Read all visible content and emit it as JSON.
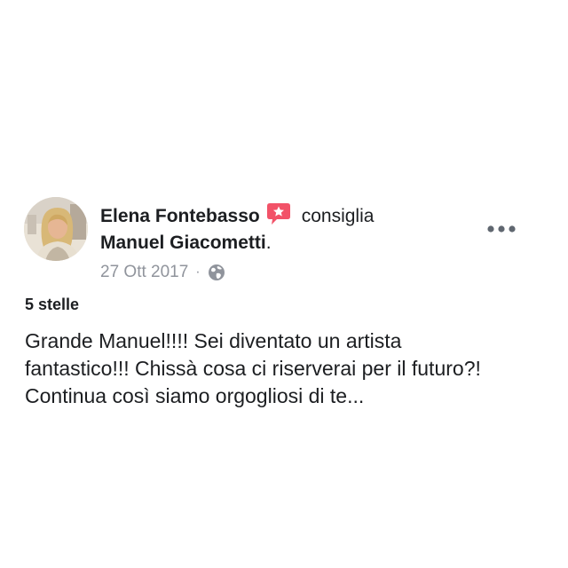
{
  "post": {
    "author": "Elena Fontebasso",
    "recommends_verb": "consiglia",
    "page_name": "Manuel Giacometti",
    "period": ".",
    "date": "27 Ott 2017",
    "separator": "·",
    "privacy_icon": "globe-icon",
    "recommend_icon": "recommendation-badge-icon",
    "more_icon": "more-options-icon",
    "rating": "5 stelle",
    "body_lines": [
      "Grande Manuel!!!! Sei diventato un artista",
      "fantastico!!! Chissà cosa ci riserverai per il futuro?!",
      "Continua così siamo orgogliosi di te..."
    ]
  },
  "colors": {
    "text": "#1c1e21",
    "meta": "#90949c",
    "recommend_badge": "#f25268",
    "background": "#ffffff"
  }
}
